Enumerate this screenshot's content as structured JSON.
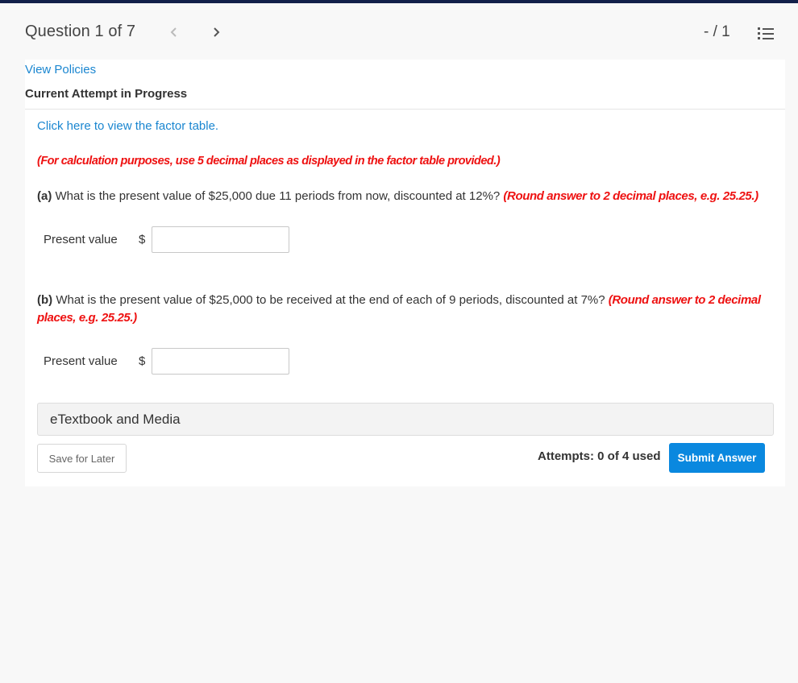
{
  "header": {
    "question_counter": "Question 1 of 7",
    "score": "- / 1",
    "prev_icon": "chevron-left-icon",
    "next_icon": "chevron-right-icon",
    "list_icon": "numbered-list-icon"
  },
  "panel": {
    "view_policies": "View Policies",
    "attempt_status": "Current Attempt in Progress",
    "factor_link": "Click here to view the factor table.",
    "calc_note": "(For calculation purposes, use 5 decimal places as displayed in the factor table provided.)",
    "part_a": {
      "label": "(a)",
      "text": " What is the present value of $25,000 due 11 periods from now, discounted at 12%? ",
      "instruction": "(Round answer to 2 decimal places, e.g. 25.25.)",
      "field_label": "Present value",
      "currency": "$",
      "value": ""
    },
    "part_b": {
      "label": "(b)",
      "text": " What is the present value of $25,000 to be received at the end of each of 9 periods, discounted at 7%? ",
      "instruction": "(Round answer to 2 decimal places, e.g. 25.25.)",
      "field_label": "Present value",
      "currency": "$",
      "value": ""
    },
    "etextbook": "eTextbook and Media",
    "save_label": "Save for Later",
    "attempts": "Attempts: 0 of 4 used",
    "submit_label": "Submit Answer"
  },
  "colors": {
    "topbar": "#13204a",
    "link": "#1a86d0",
    "alert": "#ee1111",
    "submit": "#0a88df"
  }
}
